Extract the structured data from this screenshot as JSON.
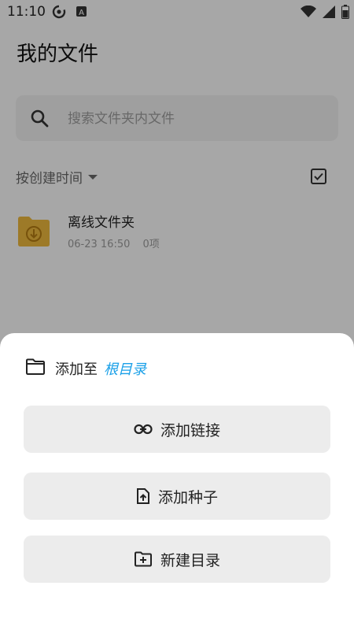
{
  "status_bar": {
    "time": "11:10",
    "left_icons": [
      "sync-icon",
      "a-letter-icon"
    ],
    "right_icons": [
      "wifi-icon",
      "signal-icon",
      "battery-icon"
    ]
  },
  "page": {
    "title": "我的文件",
    "search": {
      "placeholder": "搜索文件夹内文件",
      "value": ""
    },
    "sort_label": "按创建时间",
    "files": [
      {
        "name": "离线文件夹",
        "date": "06-23 16:50",
        "count": "0项",
        "icon": "download-folder-icon",
        "color": "#e8b43c"
      }
    ]
  },
  "sheet": {
    "title": "添加至",
    "target": "根目录",
    "target_color": "#1aa0e8",
    "actions": [
      {
        "label": "添加链接",
        "icon": "link-icon"
      },
      {
        "label": "添加种子",
        "icon": "upload-file-icon"
      },
      {
        "label": "新建目录",
        "icon": "new-folder-icon"
      }
    ]
  }
}
